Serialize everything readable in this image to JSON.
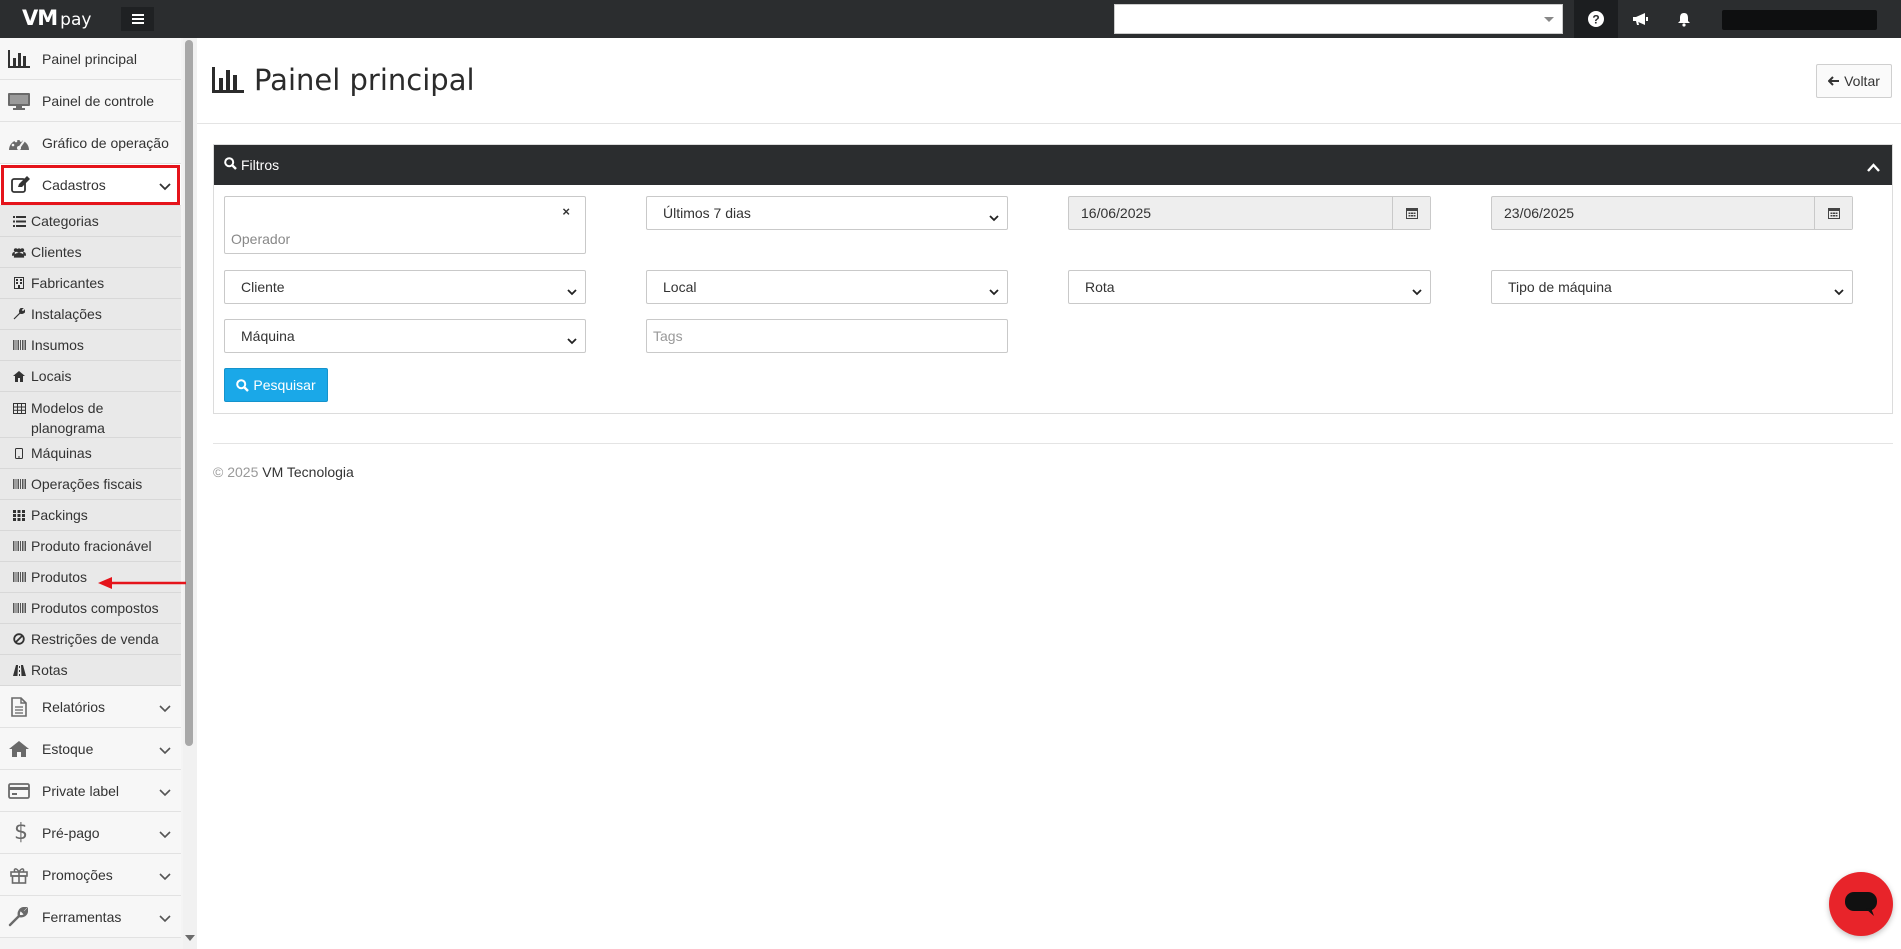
{
  "app": {
    "logo_main": "VM",
    "logo_sub": "pay"
  },
  "topbar": {
    "search_value": "",
    "icons": [
      "help-icon",
      "bullhorn-icon",
      "bell-icon"
    ]
  },
  "sidebar": {
    "main_top": [
      {
        "label": "Painel principal",
        "icon": "bar-chart-icon"
      },
      {
        "label": "Painel de controle",
        "icon": "monitor-icon"
      },
      {
        "label": "Gráfico de operação",
        "icon": "dashboard-gauge-icon"
      },
      {
        "label": "Cadastros",
        "icon": "edit-icon"
      }
    ],
    "sub_items": [
      {
        "label": "Categorias",
        "icon": "list-icon"
      },
      {
        "label": "Clientes",
        "icon": "users-icon"
      },
      {
        "label": "Fabricantes",
        "icon": "building-icon"
      },
      {
        "label": "Instalações",
        "icon": "wrench-icon"
      },
      {
        "label": "Insumos",
        "icon": "barcode-icon"
      },
      {
        "label": "Locais",
        "icon": "home-icon"
      },
      {
        "label": "Modelos de planograma",
        "icon": "table-icon"
      },
      {
        "label": "Máquinas",
        "icon": "tablet-icon"
      },
      {
        "label": "Operações fiscais",
        "icon": "barcode-icon"
      },
      {
        "label": "Packings",
        "icon": "grid-icon"
      },
      {
        "label": "Produto fracionável",
        "icon": "barcode-icon"
      },
      {
        "label": "Produtos",
        "icon": "barcode-icon"
      },
      {
        "label": "Produtos compostos",
        "icon": "barcode-icon"
      },
      {
        "label": "Restrições de venda",
        "icon": "ban-icon"
      },
      {
        "label": "Rotas",
        "icon": "road-icon"
      }
    ],
    "main_bottom": [
      {
        "label": "Relatórios",
        "icon": "file-icon"
      },
      {
        "label": "Estoque",
        "icon": "home-icon"
      },
      {
        "label": "Private label",
        "icon": "credit-card-icon"
      },
      {
        "label": "Pré-pago",
        "icon": "dollar-icon"
      },
      {
        "label": "Promoções",
        "icon": "gift-icon"
      },
      {
        "label": "Ferramentas",
        "icon": "wrench-icon"
      }
    ]
  },
  "main": {
    "title": "Painel principal",
    "back_label": "Voltar"
  },
  "filters": {
    "header": "Filtros",
    "operador_placeholder": "Operador",
    "operador_clear": "×",
    "period": "Últimos 7 dias",
    "date_start": "16/06/2025",
    "date_end": "23/06/2025",
    "cliente": "Cliente",
    "local": "Local",
    "rota": "Rota",
    "tipo_maquina": "Tipo de máquina",
    "maquina": "Máquina",
    "tags_placeholder": "Tags",
    "search_label": "Pesquisar"
  },
  "footer": {
    "copyright": "© 2025",
    "company": "VM Tecnologia"
  },
  "colors": {
    "topbar": "#2b2d2f",
    "accent": "#1aa8e8",
    "highlight": "#e5141b",
    "chat": "#e8242a"
  }
}
